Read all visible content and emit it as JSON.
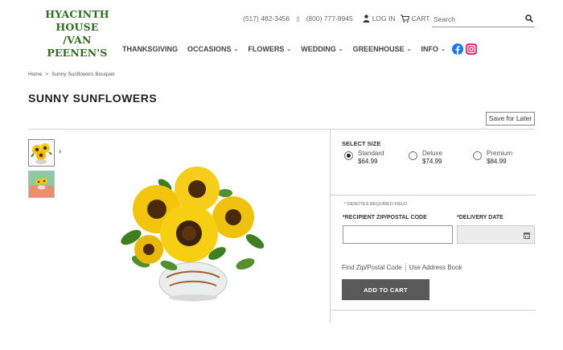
{
  "header": {
    "logo_line1": "HYACINTH HOUSE",
    "logo_line2": "/VAN PEENEN'S",
    "phone1": "(517) 482-3456",
    "phone_sep": "||",
    "phone2": "(800) 777-9945",
    "login_label": "LOG IN",
    "cart_label": "CART",
    "search_placeholder": "Search"
  },
  "nav": {
    "items": [
      {
        "label": "THANKSGIVING",
        "has_caret": false
      },
      {
        "label": "OCCASIONS",
        "has_caret": true
      },
      {
        "label": "FLOWERS",
        "has_caret": true
      },
      {
        "label": "WEDDING",
        "has_caret": true
      },
      {
        "label": "GREENHOUSE",
        "has_caret": true
      },
      {
        "label": "INFO",
        "has_caret": true
      }
    ],
    "social": [
      "facebook-icon",
      "instagram-icon"
    ]
  },
  "breadcrumb": {
    "home": "Home",
    "separator": ">",
    "current": "Sunny Sunflowers Bouquet"
  },
  "product": {
    "title": "SUNNY SUNFLOWERS",
    "save_for_later": "Save for Later",
    "thumb_next": "›"
  },
  "size": {
    "label": "SELECT SIZE",
    "options": [
      {
        "name": "Standard",
        "price": "$64.99",
        "selected": true
      },
      {
        "name": "Deluxe",
        "price": "$74.99",
        "selected": false
      },
      {
        "name": "Premium",
        "price": "$84.99",
        "selected": false
      }
    ]
  },
  "delivery": {
    "required_note": "* DENOTES REQUIRED FIELD",
    "zip_label": "*RECIPIENT ZIP/POSTAL CODE",
    "date_label": "*DELIVERY DATE",
    "zip_value": "",
    "find_zip": "Find Zip/Postal Code",
    "address_book": "Use Address Book",
    "add_to_cart": "ADD TO CART"
  },
  "colors": {
    "logo_green": "#2f6b1f",
    "button_gray": "#595959",
    "facebook_blue": "#1877f2",
    "instagram_pink": "#e1306c"
  }
}
